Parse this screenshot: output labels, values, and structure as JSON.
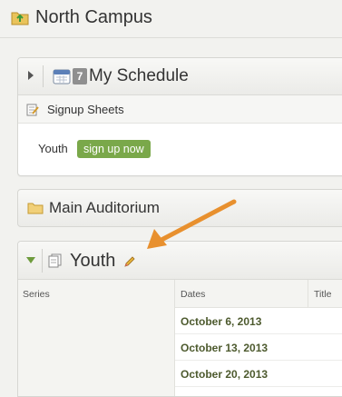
{
  "header": {
    "title": "North Campus",
    "icon": "folder-upload-icon"
  },
  "schedule": {
    "title": "My Schedule",
    "badge": "7",
    "signup_sheets_label": "Signup Sheets",
    "signup_item_label": "Youth",
    "signup_button_label": "sign up now"
  },
  "auditorium": {
    "title": "Main Auditorium"
  },
  "youth": {
    "title": "Youth",
    "columns": {
      "series": "Series",
      "dates": "Dates",
      "title": "Title"
    },
    "dates": [
      "October 6, 2013",
      "October 13, 2013",
      "October 20, 2013"
    ]
  },
  "colors": {
    "accent_green": "#7aa84a",
    "annotation_orange": "#e8902e",
    "date_text": "#4d5a2e"
  }
}
